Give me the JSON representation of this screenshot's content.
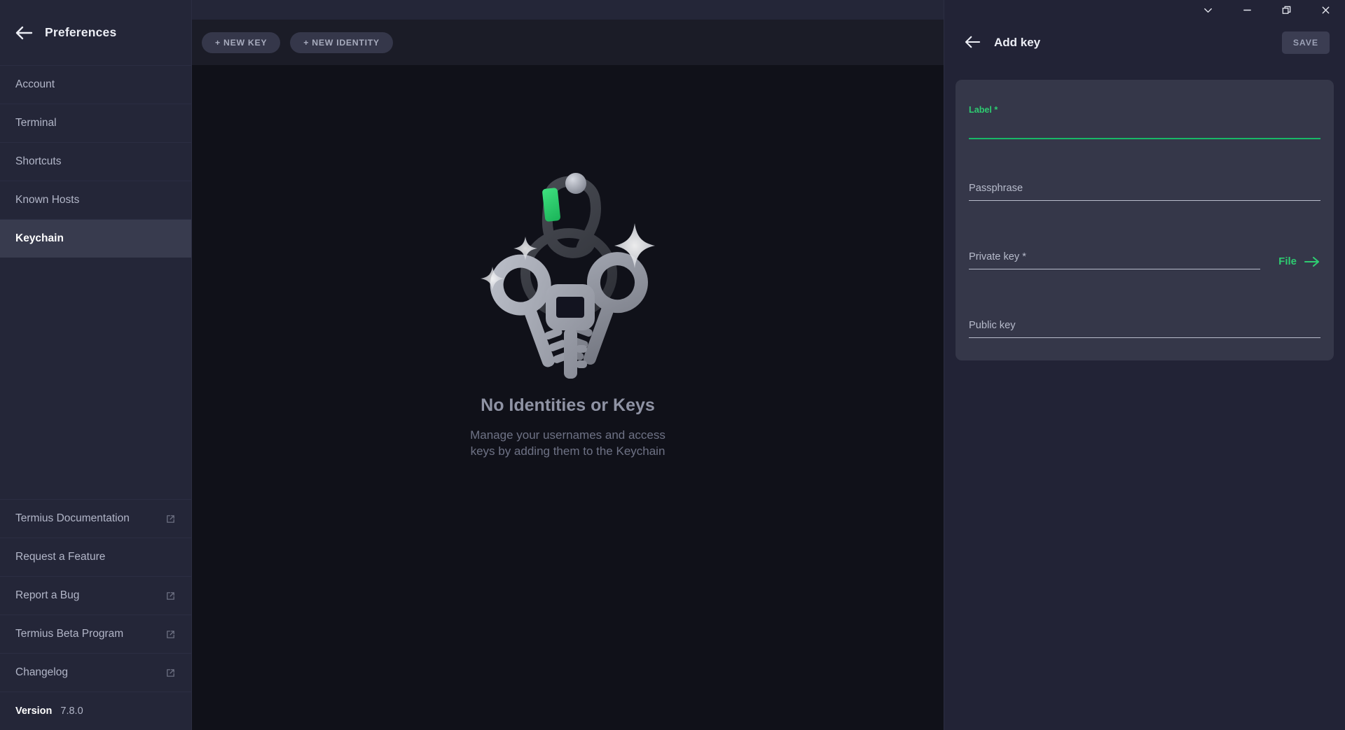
{
  "window": {
    "controls": [
      {
        "name": "chevron-down-icon",
        "label": "Collapse"
      },
      {
        "name": "minimize-icon",
        "label": "Minimize"
      },
      {
        "name": "restore-icon",
        "label": "Restore"
      },
      {
        "name": "close-icon",
        "label": "Close"
      }
    ]
  },
  "sidebar": {
    "back_icon": "back-arrow-icon",
    "title": "Preferences",
    "items": [
      {
        "label": "Account",
        "external": false,
        "selected": false
      },
      {
        "label": "Terminal",
        "external": false,
        "selected": false
      },
      {
        "label": "Shortcuts",
        "external": false,
        "selected": false
      },
      {
        "label": "Known Hosts",
        "external": false,
        "selected": false
      },
      {
        "label": "Keychain",
        "external": false,
        "selected": true
      }
    ],
    "links": [
      {
        "label": "Termius Documentation",
        "external": true
      },
      {
        "label": "Request a Feature",
        "external": false
      },
      {
        "label": "Report a Bug",
        "external": true
      },
      {
        "label": "Termius Beta Program",
        "external": true
      },
      {
        "label": "Changelog",
        "external": true
      }
    ],
    "version": {
      "label": "Version",
      "value": "7.8.0"
    }
  },
  "main": {
    "toolbar": {
      "new_key_label": "+ NEW KEY",
      "new_identity_label": "+ NEW IDENTITY"
    },
    "empty_state": {
      "illustration": "keyring-keys-illustration",
      "title": "No Identities or Keys",
      "description": "Manage your usernames and access keys by adding them to the Keychain"
    }
  },
  "right_panel": {
    "back_icon": "back-arrow-icon",
    "title": "Add key",
    "save_label": "SAVE",
    "fields": [
      {
        "label": "Label *",
        "value": "",
        "placeholder": "",
        "focused": true,
        "name": "label-field"
      },
      {
        "label": "Passphrase",
        "value": "",
        "placeholder": "",
        "focused": false,
        "name": "passphrase-field"
      },
      {
        "label": "Private key *",
        "value": "",
        "placeholder": "",
        "focused": false,
        "name": "private-key-field"
      },
      {
        "label": "Public key",
        "value": "",
        "placeholder": "",
        "focused": false,
        "name": "public-key-field"
      }
    ],
    "file_link_label": "File"
  },
  "colors": {
    "accent_green": "#2ecc71",
    "sidebar_bg": "#242638",
    "sidebar_selected": "#383b4e",
    "content_bg": "#101119",
    "panel_bg": "#222336",
    "card_bg": "#353749"
  }
}
